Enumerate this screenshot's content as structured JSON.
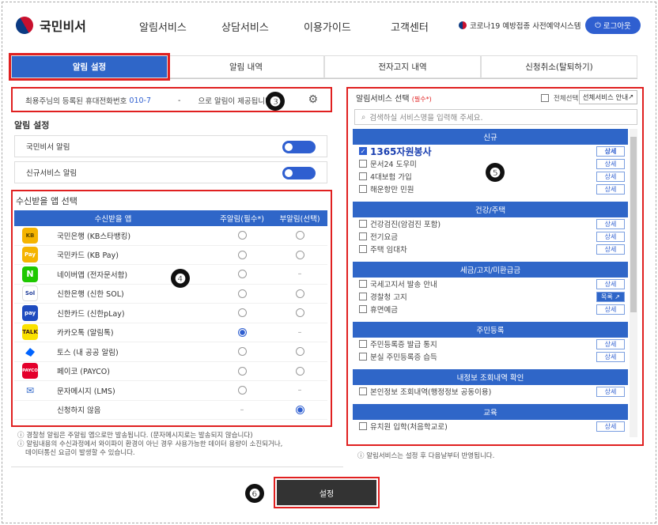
{
  "header": {
    "logo_text": "국민비서",
    "nav": [
      "알림서비스",
      "상담서비스",
      "이용가이드",
      "고객센터"
    ],
    "covid_link": "코로나19 예방접종 사전예약시스템",
    "logout": "로그아웃"
  },
  "tabs": [
    "알림 설정",
    "알림 내역",
    "전자고지 내역",
    "신청취소(탈퇴하기)"
  ],
  "phone_notice": {
    "prefix": "최용주님의 등록된 휴대전화번호",
    "number": "010-7",
    "sep": "-",
    "suffix": "으로 알림이 제공됩니다."
  },
  "markers": [
    "❸",
    "❹",
    "❺",
    "❻"
  ],
  "alert_settings": {
    "title": "알림 설정",
    "rows": [
      "국민비서 알림",
      "신규서비스 알림"
    ]
  },
  "app_select": {
    "title": "수신받을 앱 선택",
    "headers": [
      "수신받을 앱",
      "주알림(필수*)",
      "부알림(선택)"
    ],
    "rows": [
      {
        "icon": "kb-bank-icon",
        "label": "KB",
        "name": "국민은행 (KB스타뱅킹)",
        "main": "off",
        "sub": "off"
      },
      {
        "icon": "kb-pay-icon",
        "label": "Pay",
        "name": "국민카드 (KB Pay)",
        "main": "off",
        "sub": "off"
      },
      {
        "icon": "naver-icon",
        "label": "N",
        "name": "네이버앱 (전자문서함)",
        "main": "off",
        "sub": "dash"
      },
      {
        "icon": "shinhan-sol-icon",
        "label": "Sol",
        "name": "신한은행 (신한 SOL)",
        "main": "off",
        "sub": "off"
      },
      {
        "icon": "shinhan-play-icon",
        "label": "pay",
        "name": "신한카드 (신한pLay)",
        "main": "off",
        "sub": "off"
      },
      {
        "icon": "kakaotalk-icon",
        "label": "TALK",
        "name": "카카오톡 (알림톡)",
        "main": "on",
        "sub": "dash"
      },
      {
        "icon": "toss-icon",
        "label": "",
        "name": "토스 (내 공공 알림)",
        "main": "off",
        "sub": "off"
      },
      {
        "icon": "payco-icon",
        "label": "PAYCO",
        "name": "페이코 (PAYCO)",
        "main": "off",
        "sub": "off"
      },
      {
        "icon": "sms-icon",
        "label": "✉",
        "name": "문자메시지 (LMS)",
        "main": "off",
        "sub": "dash"
      },
      {
        "icon": "",
        "label": "",
        "name": "신청하지 않음",
        "main": "dash",
        "sub": "on"
      }
    ],
    "notes": [
      "ⓘ 경찰청 알림은 주알림 앱으로만 발송됩니다. (문자메시지로는 발송되지 않습니다)",
      "ⓘ 알림내용의 수신과정에서 와이파이 환경이 아닌 경우 사용가능한 데이터 용량이 소진되거나,",
      "데이터통신 요금이 발생할 수 있습니다."
    ]
  },
  "service_select": {
    "title": "알림서비스 선택",
    "required": "(필수*)",
    "all_check": "전체선택",
    "guide_button": "선체서비스 안내",
    "search_placeholder": "검색하실 서비스명을 입력해 주세요.",
    "groups": [
      {
        "name": "신규",
        "items": [
          {
            "label": "1365자원봉사",
            "checked": true,
            "highlight": true,
            "btn": "상세"
          },
          {
            "label": "문서24 도우미",
            "checked": false,
            "btn": "상세"
          },
          {
            "label": "4대보험 가입",
            "checked": false,
            "btn": "상세"
          },
          {
            "label": "해운항만 민원",
            "checked": false,
            "btn": "상세"
          }
        ]
      },
      {
        "name": "건강/주택",
        "items": [
          {
            "label": "건강검진(암검진 포함)",
            "checked": false,
            "btn": "상세"
          },
          {
            "label": "전기요금",
            "checked": false,
            "btn": "상세"
          },
          {
            "label": "주택 임대차",
            "checked": false,
            "btn": "상세"
          }
        ]
      },
      {
        "name": "세금/고지/미환급금",
        "items": [
          {
            "label": "국세고지서 발송 안내",
            "checked": false,
            "btn": "상세"
          },
          {
            "label": "경찰청 고지",
            "checked": false,
            "btn": "목록 ↗",
            "dark": true
          },
          {
            "label": "휴면예금",
            "checked": false,
            "btn": "상세"
          }
        ]
      },
      {
        "name": "주민등록",
        "items": [
          {
            "label": "주민등록증 발급 통지",
            "checked": false,
            "btn": "상세"
          },
          {
            "label": "분실 주민등록증 습득",
            "checked": false,
            "btn": "상세"
          }
        ]
      },
      {
        "name": "내정보 조회내역 확인",
        "items": [
          {
            "label": "본인정보 조회내역(행정정보 공동이용)",
            "checked": false,
            "btn": "상세"
          }
        ]
      },
      {
        "name": "교육",
        "items": [
          {
            "label": "유치원 입학(처음학교로)",
            "checked": false,
            "btn": "상세"
          }
        ]
      }
    ],
    "note": "ⓘ 알림서비스는 설정 후 다음날부터 반영됩니다."
  },
  "submit": "설정"
}
